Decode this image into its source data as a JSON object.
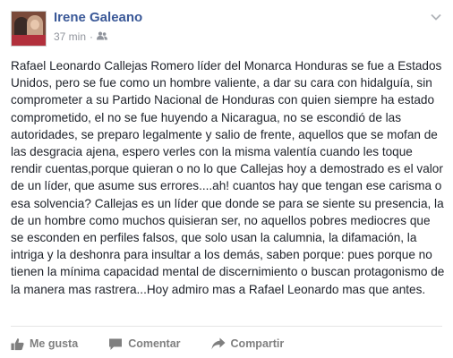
{
  "post": {
    "author": "Irene Galeano",
    "timestamp": "37 min",
    "separator": "·",
    "audience_icon": "friends-icon",
    "text": "Rafael Leonardo Callejas Romero líder del Monarca Honduras se fue a Estados Unidos, pero se fue como un hombre valiente, a dar su cara con hidalguía, sin comprometer a su Partido Nacional de Honduras con quien siempre ha estado comprometido, el no se fue huyendo a Nicaragua, no se escondió de las autoridades, se preparo legalmente y salio de frente, aquellos que se mofan de las desgracia ajena, espero verles con la misma valentía cuando les toque rendir cuentas,porque quieran o no lo que Callejas hoy a demostrado es el valor de un líder, que asume sus errores....ah! cuantos hay que tengan ese carisma o esa solvencia? Callejas es un líder que donde se para se siente su presencia, la de un hombre como muchos quisieran ser, no aquellos pobres mediocres que se esconden en perfiles falsos, que solo usan la calumnia, la difamación, la intriga y la deshonra para insultar a los demás, saben porque: pues porque no tienen la mínima capacidad mental de discernimiento o buscan protagonismo de la manera mas rastrera...Hoy admiro mas a Rafael Leonardo mas que antes."
  },
  "actions": {
    "like_label": "Me gusta",
    "comment_label": "Comentar",
    "share_label": "Compartir"
  },
  "colors": {
    "author": "#3b5998",
    "meta": "#90949c",
    "text": "#1d2129",
    "action": "#7f7f7f"
  }
}
